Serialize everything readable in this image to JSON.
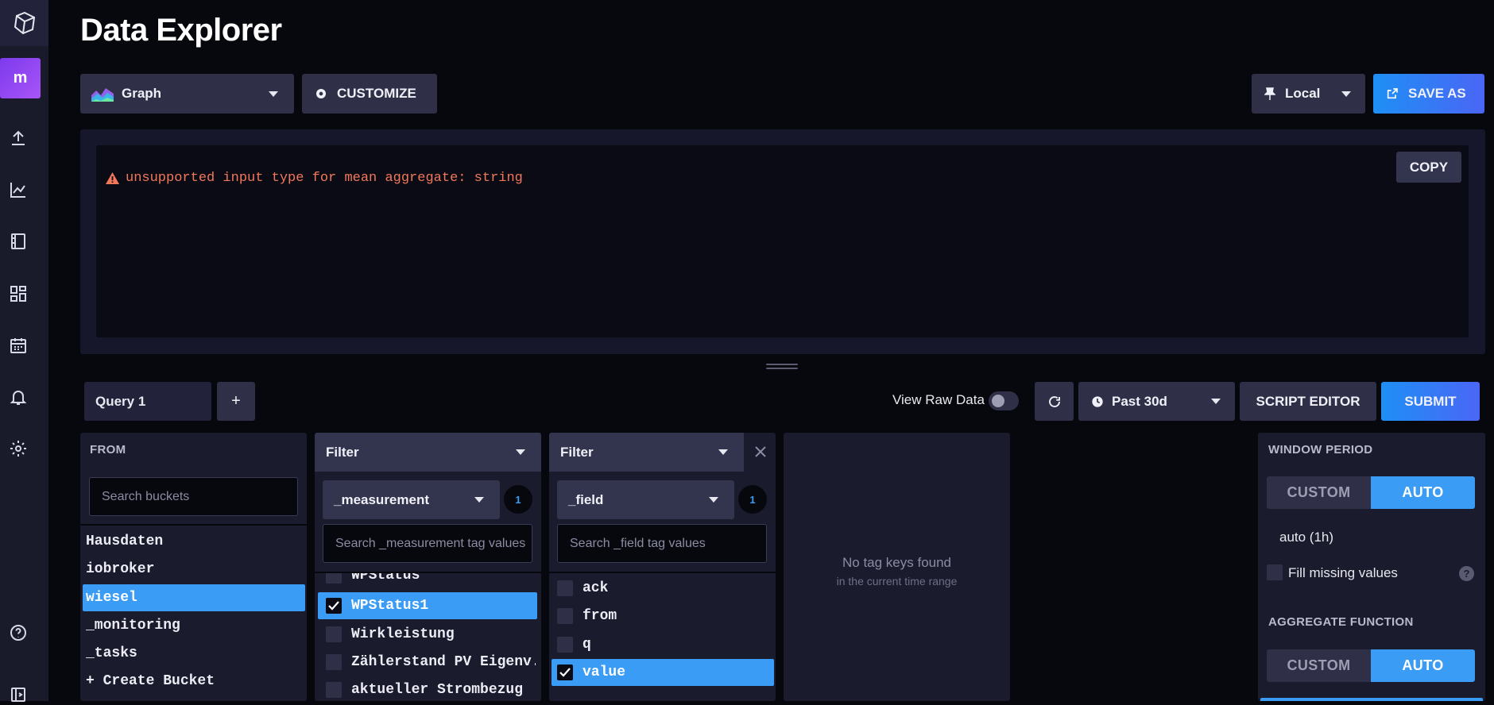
{
  "page": {
    "title": "Data Explorer"
  },
  "sidebar": {
    "org_initial": "m"
  },
  "toolbar": {
    "vis_type": "Graph",
    "customize_label": "CUSTOMIZE",
    "timezone_label": "Local",
    "save_as_label": "SAVE AS"
  },
  "result": {
    "error_message": "unsupported input type for mean aggregate: string",
    "copy_label": "COPY"
  },
  "query_bar": {
    "tab_label": "Query 1",
    "add_label": "+",
    "raw_data_label": "View Raw Data",
    "time_range": "Past 30d",
    "script_editor_label": "SCRIPT EDITOR",
    "submit_label": "SUBMIT"
  },
  "from_panel": {
    "label": "FROM",
    "search_placeholder": "Search buckets",
    "buckets": [
      "Hausdaten",
      "iobroker",
      "wiesel",
      "_monitoring",
      "_tasks"
    ],
    "selected": "wiesel",
    "create_label": "+ Create Bucket"
  },
  "filter1": {
    "label": "Filter",
    "key": "_measurement",
    "count": "1",
    "search_placeholder": "Search _measurement tag values",
    "items": [
      "WPStatus",
      "WPStatus1",
      "Wirkleistung",
      "Zählerstand PV Eigenv...",
      "aktueller Strombezug"
    ],
    "selected": "WPStatus1"
  },
  "filter2": {
    "label": "Filter",
    "key": "_field",
    "count": "1",
    "search_placeholder": "Search _field tag values",
    "items": [
      "ack",
      "from",
      "q",
      "value"
    ],
    "selected": "value"
  },
  "empty_panel": {
    "title": "No tag keys found",
    "subtitle": "in the current time range"
  },
  "window_panel": {
    "window_label": "WINDOW PERIOD",
    "custom_label": "CUSTOM",
    "auto_label": "AUTO",
    "period_value": "auto (1h)",
    "fill_label": "Fill missing values",
    "help_label": "?",
    "aggregate_label": "AGGREGATE FUNCTION",
    "agg_custom_label": "CUSTOM",
    "agg_auto_label": "AUTO"
  }
}
